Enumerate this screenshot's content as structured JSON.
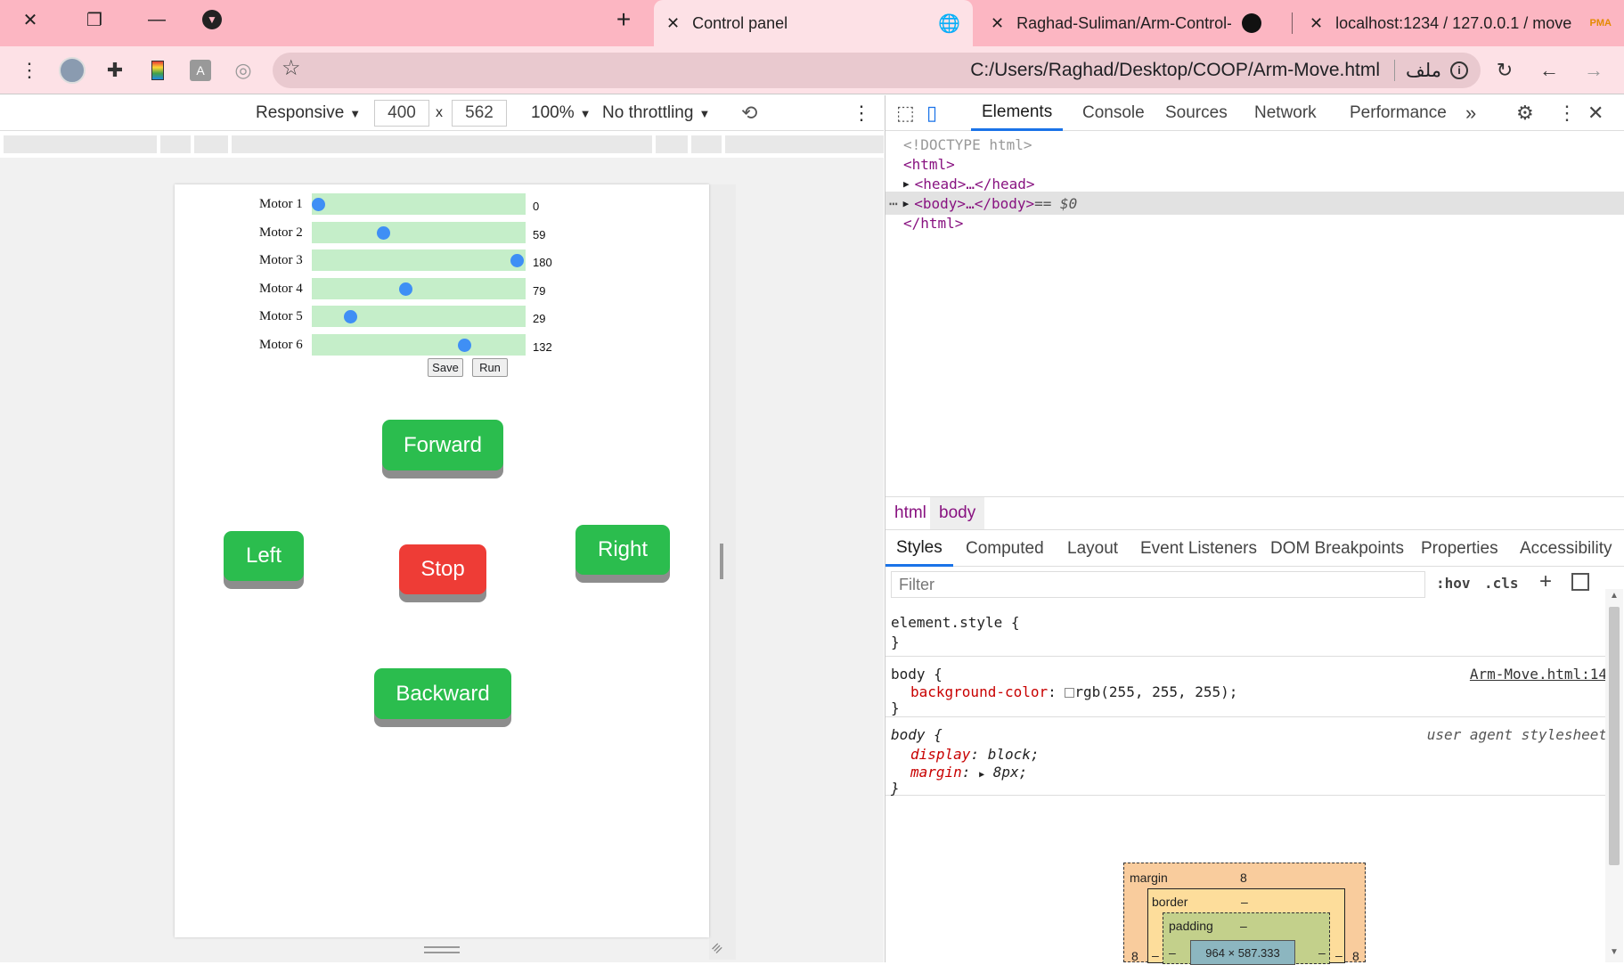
{
  "tabs": [
    {
      "title": "Control panel"
    },
    {
      "title": "Raghad-Suliman/Arm-Control-Ta"
    },
    {
      "title": "localhost:1234 / 127.0.0.1 / move"
    }
  ],
  "address": {
    "url": "C:/Users/Raghad/Desktop/COOP/Arm-Move.html",
    "label": "ملف"
  },
  "device_toolbar": {
    "mode": "Responsive",
    "width": "400",
    "height": "562",
    "zoom": "100%",
    "throttling": "No throttling",
    "times": "x"
  },
  "page": {
    "motors": [
      {
        "label": "Motor 1",
        "value": "0",
        "level": 0
      },
      {
        "label": "Motor 2",
        "value": "59",
        "level": 59
      },
      {
        "label": "Motor 3",
        "value": "180",
        "level": 180
      },
      {
        "label": "Motor 4",
        "value": "79",
        "level": 79
      },
      {
        "label": "Motor 5",
        "value": "29",
        "level": 29
      },
      {
        "label": "Motor 6",
        "value": "132",
        "level": 132
      }
    ],
    "slider_max": 180,
    "save_label": "Save",
    "run_label": "Run",
    "controls": {
      "forward": "Forward",
      "left": "Left",
      "stop": "Stop",
      "right": "Right",
      "backward": "Backward"
    },
    "colors": {
      "go": "#2bbd4e",
      "stop": "#ee3c36",
      "track": "#c5eec9",
      "knob": "#3f8ff5"
    }
  },
  "devtools": {
    "tabs": [
      "Elements",
      "Console",
      "Sources",
      "Network",
      "Performance"
    ],
    "dom": {
      "doctype": "<!DOCTYPE html>",
      "html_open": "<html>",
      "head": "<head>…</head>",
      "body": "<body>…</body>",
      "body_suffix": " == $0",
      "html_close": "</html>"
    },
    "breadcrumbs": [
      "html",
      "body"
    ],
    "style_tabs": [
      "Styles",
      "Computed",
      "Layout",
      "Event Listeners",
      "DOM Breakpoints",
      "Properties",
      "Accessibility"
    ],
    "filter_placeholder": "Filter",
    "hov": ":hov",
    "cls": ".cls",
    "rules": {
      "element_style": "element.style {",
      "close": "}",
      "body1_selector": "body {",
      "body1_source": "Arm-Move.html:14",
      "body1_prop": "background-color",
      "body1_value": "rgb(255, 255, 255);",
      "body2_selector": "body {",
      "body2_source": "user agent stylesheet",
      "body2_prop1": "display",
      "body2_value1": "block;",
      "body2_prop2": "margin",
      "body2_value2": "8px;"
    },
    "box_model": {
      "margin_label": "margin",
      "margin": "8",
      "border_label": "border",
      "border": "–",
      "padding_label": "padding",
      "padding": "–",
      "side": "8",
      "dash": "–",
      "content": "964 × 587.333"
    }
  }
}
